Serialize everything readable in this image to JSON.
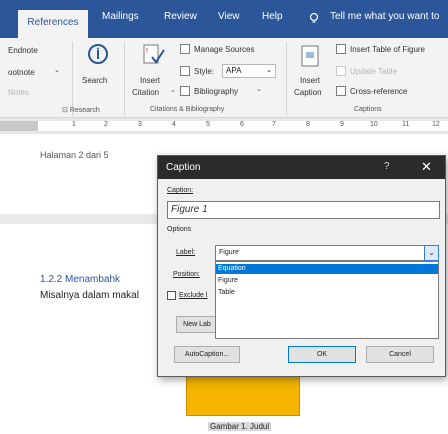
{
  "tabs": [
    "References",
    "Mailings",
    "Review",
    "View",
    "Help"
  ],
  "tell_me": "Tell me what you want to",
  "ribbon": {
    "endnote": "Endnote",
    "footnote": "ootnote",
    "notes": "Notes",
    "search": "Search",
    "research_group": "Research",
    "insert_citation": [
      "Insert",
      "Citation"
    ],
    "manage_sources": "Manage Sources",
    "style_label": "Style:",
    "style_value": "APA",
    "bibliography": "Bibliography",
    "citations_group": "Citations & Bibliography",
    "insert_caption": [
      "Insert",
      "Caption"
    ],
    "insert_table_of_figures": "Insert Table of Figure",
    "update_table": "Update Table",
    "cross_reference": "Cross-reference",
    "captions_group": "Captions"
  },
  "ruler": [
    "1",
    "2",
    "3",
    "4",
    "5",
    "6",
    "7",
    "8",
    "9",
    "10",
    "11",
    "12"
  ],
  "document": {
    "page_label": "Halaman 2 dari 5",
    "heading": "1.2.2   Menambahk",
    "paragraph": "Misalnya dalam makal",
    "figure_caption": "Gambar 1. Judul"
  },
  "dialog": {
    "title": "Caption",
    "help": "?",
    "caption_label": "Caption:",
    "caption_value": "Figure 1",
    "options_label": "Options",
    "label_label": "Label:",
    "label_value": "Figure",
    "label_options": [
      "Equation",
      "Figure",
      "Table"
    ],
    "position_label": "Position:",
    "exclude_label": "Exclude l",
    "new_label_button": "New Lab",
    "autocaption_button": "AutoCaption...",
    "ok_button": "OK",
    "cancel_button": "Cancel"
  },
  "colors": {
    "ribbon_blue": "#2b579a",
    "selection_blue": "#0078d7",
    "figure_yellow": "#f4b400"
  }
}
